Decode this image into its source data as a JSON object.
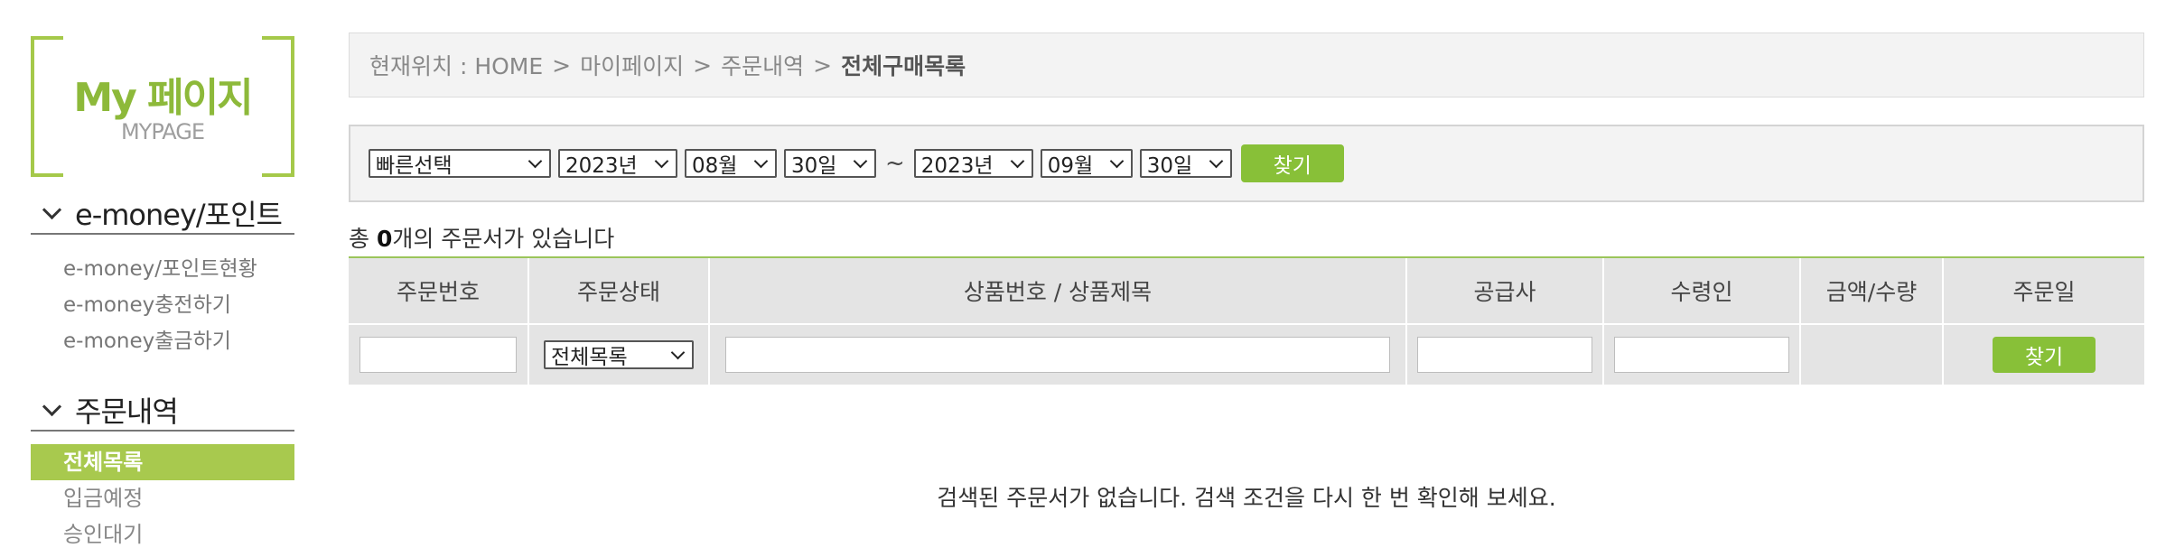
{
  "sidebar": {
    "logo_main": "My 페이지",
    "logo_sub": "MYPAGE",
    "section1": {
      "title": "e-money/포인트",
      "items": [
        "e-money/포인트현황",
        "e-money충전하기",
        "e-money출금하기"
      ]
    },
    "section2": {
      "title": "주문내역",
      "items": [
        "전체목록",
        "입금예정",
        "승인대기"
      ],
      "active_index": 0
    }
  },
  "breadcrumb": {
    "prefix": "현재위치 : HOME",
    "sep": ">",
    "items": [
      "마이페이지",
      "주문내역"
    ],
    "current": "전체구매목록"
  },
  "search": {
    "quick_select": "빠른선택",
    "from_year": "2023년",
    "from_month": "08월",
    "from_day": "30일",
    "tilde": "~",
    "to_year": "2023년",
    "to_month": "09월",
    "to_day": "30일",
    "find_label": "찾기"
  },
  "summary": {
    "prefix": "총 ",
    "count": "0",
    "suffix": "개의 주문서가 있습니다"
  },
  "table": {
    "headers": [
      "주문번호",
      "주문상태",
      "상품번호 / 상품제목",
      "공급사",
      "수령인",
      "금액/수량",
      "주문일"
    ],
    "status_select": "전체목록",
    "find_label": "찾기"
  },
  "empty_message": "검색된 주문서가 없습니다. 검색 조건을 다시 한 번 확인해 보세요.",
  "colors": {
    "accent_green": "#88c038",
    "sidebar_active": "#a8c94e",
    "logo_green": "#8db93a"
  }
}
